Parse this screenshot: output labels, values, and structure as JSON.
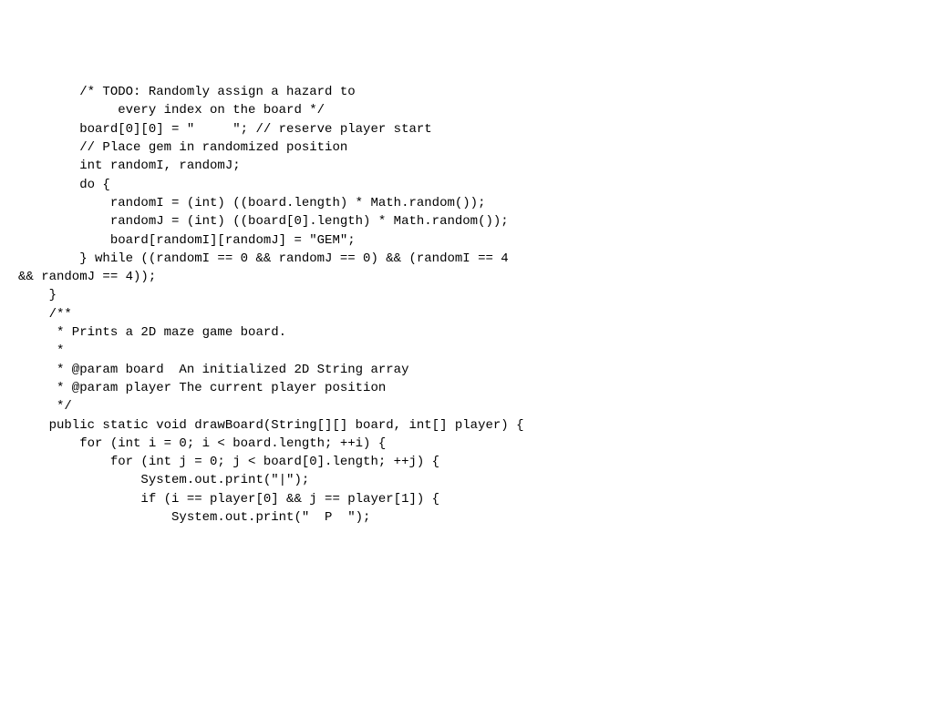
{
  "code": {
    "lines": [
      "        /* TODO: Randomly assign a hazard to",
      "             every index on the board */",
      "",
      "",
      "",
      "",
      "        board[0][0] = \"     \"; // reserve player start",
      "",
      "        // Place gem in randomized position",
      "        int randomI, randomJ;",
      "        do {",
      "            randomI = (int) ((board.length) * Math.random());",
      "            randomJ = (int) ((board[0].length) * Math.random());",
      "",
      "            board[randomI][randomJ] = \"GEM\";",
      "        } while ((randomI == 0 && randomJ == 0) && (randomI == 4",
      "&& randomJ == 4));",
      "",
      "    }",
      "",
      "    /**",
      "     * Prints a 2D maze game board.",
      "     *",
      "     * @param board  An initialized 2D String array",
      "     * @param player The current player position",
      "     */",
      "    public static void drawBoard(String[][] board, int[] player) {",
      "",
      "        for (int i = 0; i < board.length; ++i) {",
      "            for (int j = 0; j < board[0].length; ++j) {",
      "                System.out.print(\"|\");",
      "                if (i == player[0] && j == player[1]) {",
      "                    System.out.print(\"  P  \");"
    ]
  }
}
